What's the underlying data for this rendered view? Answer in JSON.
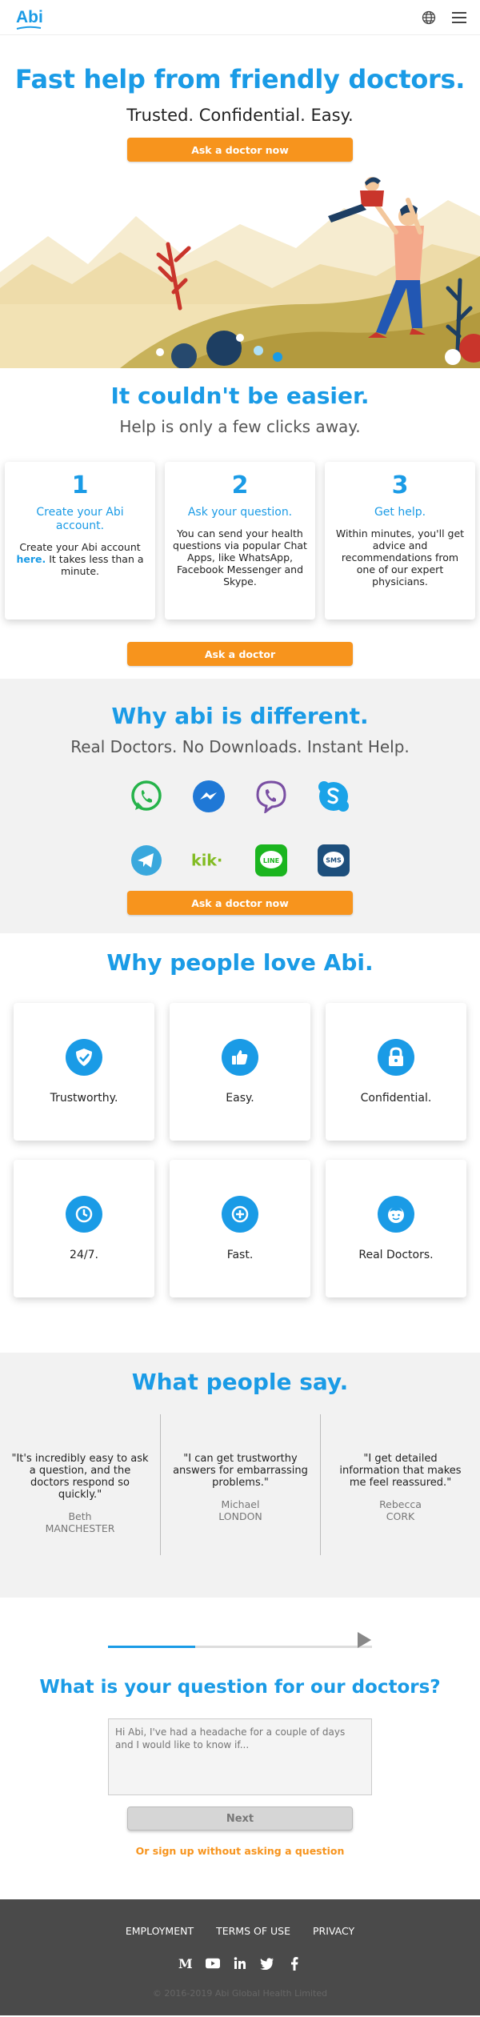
{
  "header": {
    "logo": "Abi",
    "globe_icon": "globe-icon",
    "menu_icon": "hamburger-menu-icon"
  },
  "hero": {
    "title": "Fast help from friendly doctors.",
    "subtitle": "Trusted. Confidential. Easy.",
    "cta": "Ask a doctor now"
  },
  "easier": {
    "title": "It couldn't be easier.",
    "subtitle": "Help is only a few clicks away.",
    "steps": [
      {
        "num": "1",
        "title": "Create your Abi account.",
        "text_before": "Create your Abi account",
        "link": "here.",
        "text_after": "It takes less than a minute."
      },
      {
        "num": "2",
        "title": "Ask your question.",
        "text": "You can send your health questions via popular Chat Apps, like WhatsApp, Facebook Messenger and Skype."
      },
      {
        "num": "3",
        "title": "Get help.",
        "text": "Within minutes, you'll get advice and recommendations from one of our expert physicians."
      }
    ],
    "cta": "Ask a doctor"
  },
  "different": {
    "title": "Why abi is different.",
    "subtitle": "Real Doctors. No Downloads. Instant Help.",
    "apps": [
      "whatsapp-icon",
      "messenger-icon",
      "viber-icon",
      "skype-icon",
      "telegram-icon",
      "kik-icon",
      "line-icon",
      "sms-icon"
    ],
    "kik_text": "kik·",
    "line_text": "LINE",
    "sms_text": "SMS",
    "cta": "Ask a doctor now"
  },
  "love": {
    "title": "Why people love Abi.",
    "features": [
      {
        "label": "Trustworthy.",
        "icon": "shield-check-icon"
      },
      {
        "label": "Easy.",
        "icon": "thumbs-up-icon"
      },
      {
        "label": "Confidential.",
        "icon": "lock-icon"
      },
      {
        "label": "24/7.",
        "icon": "clock-icon"
      },
      {
        "label": "Fast.",
        "icon": "fast-plus-icon"
      },
      {
        "label": "Real Doctors.",
        "icon": "doctor-face-icon"
      }
    ]
  },
  "say": {
    "title": "What people say.",
    "quotes": [
      {
        "text": "\"It's incredibly easy to ask a question, and the doctors respond so quickly.\"",
        "name": "Beth",
        "city": "MANCHESTER"
      },
      {
        "text": "\"I can get trustworthy answers for embarrassing problems.\"",
        "name": "Michael",
        "city": "LONDON"
      },
      {
        "text": "\"I get detailed information that makes me feel reassured.\"",
        "name": "Rebecca",
        "city": "CORK"
      }
    ]
  },
  "question": {
    "progress": 0.33,
    "title": "What is your question for our doctors?",
    "placeholder": "Hi Abi, I've had a headache for a couple of days and I would like to know if...",
    "next": "Next",
    "signup": "Or sign up without asking a question"
  },
  "footer": {
    "links": [
      "EMPLOYMENT",
      "TERMS OF USE",
      "PRIVACY"
    ],
    "socials": [
      "medium-icon",
      "youtube-icon",
      "linkedin-icon",
      "twitter-icon",
      "facebook-icon"
    ],
    "copyright": "© 2016-2019 Abi Global Health Limited"
  },
  "colors": {
    "brand_blue": "#1a9be6",
    "cta_orange": "#f7941d",
    "footer_bg": "#4a4a4a",
    "section_gray": "#f2f2f2"
  }
}
